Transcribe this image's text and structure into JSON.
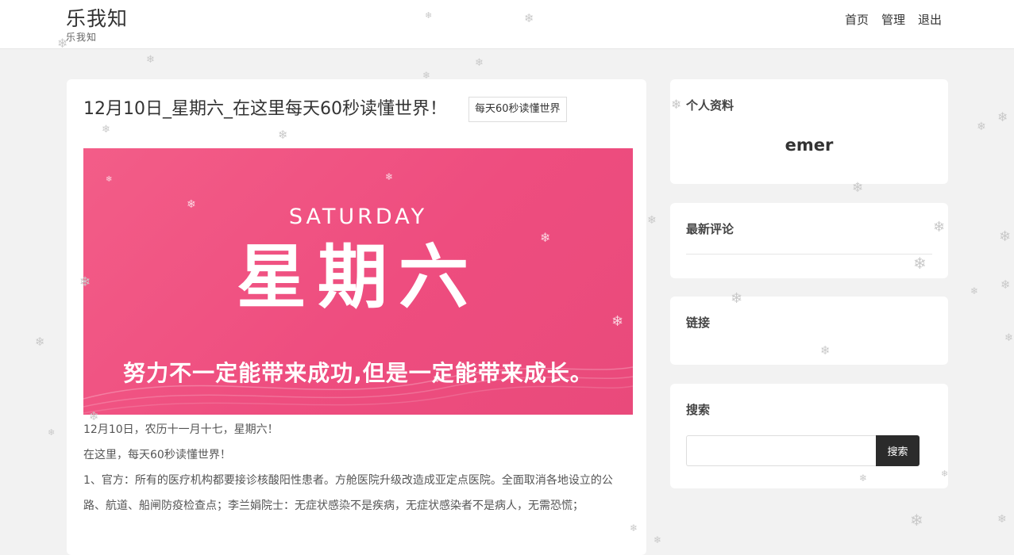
{
  "site": {
    "title": "乐我知",
    "subtitle": "乐我知"
  },
  "nav": {
    "items": [
      "首页",
      "管理",
      "退出"
    ]
  },
  "post": {
    "title": "12月10日_星期六_在这里每天60秒读懂世界！",
    "tag": "每天60秒读懂世界",
    "banner": {
      "en": "SATURDAY",
      "cn": "星期六",
      "slogan": "努力不一定能带来成功,但是一定能带来成长。",
      "background": "#ef5182"
    },
    "paragraphs": [
      "12月10日，农历十一月十七，星期六！",
      "在这里，每天60秒读懂世界！",
      "1、官方：所有的医疗机构都要接诊核酸阳性患者。方舱医院升级改造成亚定点医院。全面取消各地设立的公路、航道、船闸防疫检查点；李兰娟院士：无症状感染不是疾病，无症状感染者不是病人，无需恐慌；"
    ]
  },
  "sidebar": {
    "profile": {
      "title": "个人资料",
      "name": "emer"
    },
    "comments": {
      "title": "最新评论"
    },
    "links": {
      "title": "链接"
    },
    "search": {
      "title": "搜索",
      "placeholder": "",
      "button": "搜索"
    }
  },
  "colors": {
    "page_bg": "#f2f2f2",
    "card_bg": "#ffffff",
    "search_button": "#2b2b2b",
    "snowflake": "#c9c9c9"
  },
  "icons": {
    "decoration": "snowflake-icon"
  }
}
